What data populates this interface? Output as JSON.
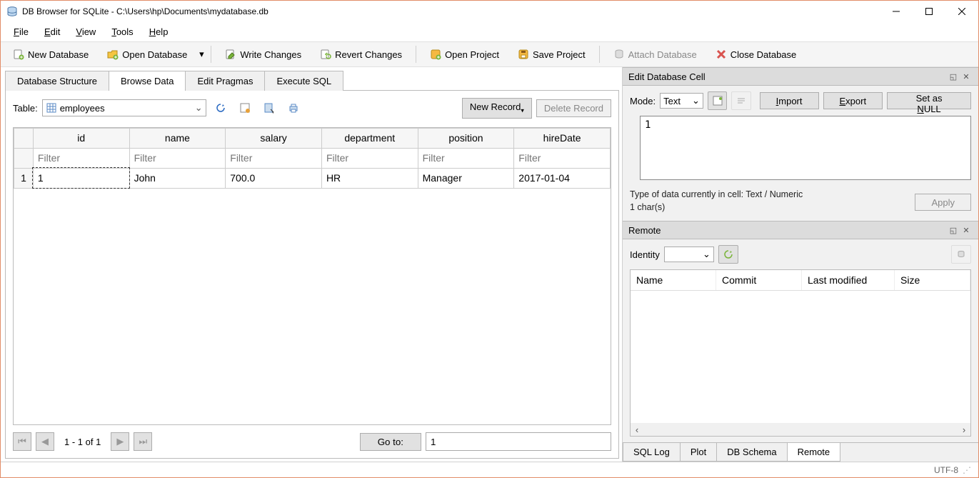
{
  "window": {
    "title": "DB Browser for SQLite - C:\\Users\\hp\\Documents\\mydatabase.db"
  },
  "menu": {
    "file": "File",
    "edit": "Edit",
    "view": "View",
    "tools": "Tools",
    "help": "Help"
  },
  "toolbar": {
    "new_db": "New Database",
    "open_db": "Open Database",
    "write_changes": "Write Changes",
    "revert_changes": "Revert Changes",
    "open_project": "Open Project",
    "save_project": "Save Project",
    "attach_db": "Attach Database",
    "close_db": "Close Database"
  },
  "tabs": {
    "structure": "Database Structure",
    "browse": "Browse Data",
    "pragmas": "Edit Pragmas",
    "execute": "Execute SQL"
  },
  "browse": {
    "table_label": "Table:",
    "table_name": "employees",
    "new_record": "New Record",
    "delete_record": "Delete Record",
    "columns": [
      "id",
      "name",
      "salary",
      "department",
      "position",
      "hireDate"
    ],
    "filter_placeholder": "Filter",
    "row_num": "1",
    "rows": [
      {
        "id": "1",
        "name": "John",
        "salary": "700.0",
        "department": "HR",
        "position": "Manager",
        "hireDate": "2017-01-04"
      }
    ],
    "pager_label": "1 - 1 of 1",
    "goto_label": "Go to:",
    "goto_value": "1"
  },
  "edit_cell": {
    "title": "Edit Database Cell",
    "mode_label": "Mode:",
    "mode_value": "Text",
    "import": "Import",
    "export": "Export",
    "set_null": "Set as NULL",
    "value": "1",
    "type_info": "Type of data currently in cell: Text / Numeric",
    "chars": "1 char(s)",
    "apply": "Apply"
  },
  "remote": {
    "title": "Remote",
    "identity_label": "Identity",
    "headers": {
      "name": "Name",
      "commit": "Commit",
      "last_modified": "Last modified",
      "size": "Size"
    }
  },
  "bottom_tabs": {
    "sql_log": "SQL Log",
    "plot": "Plot",
    "db_schema": "DB Schema",
    "remote": "Remote"
  },
  "status": {
    "encoding": "UTF-8"
  }
}
